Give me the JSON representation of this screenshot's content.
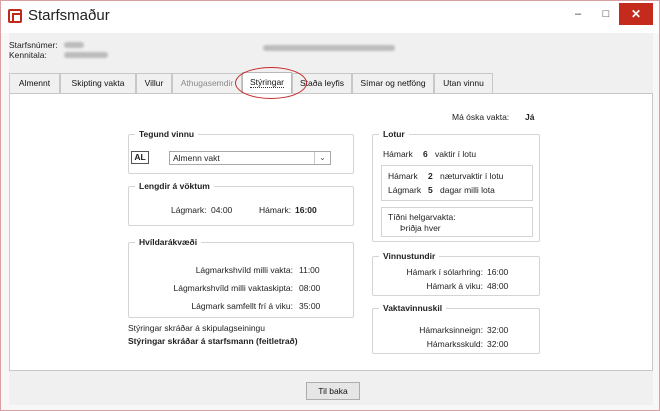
{
  "window": {
    "title": "Starfsmaður",
    "minimize_glyph": "–",
    "maximize_glyph": "□",
    "close_glyph": "✕"
  },
  "header": {
    "employee_number_label": "Starfsnúmer:",
    "ssn_label": "Kennitala:"
  },
  "tabs": [
    {
      "label": "Almennt",
      "state": "normal"
    },
    {
      "label": "Skipting vakta",
      "state": "normal"
    },
    {
      "label": "Villur",
      "state": "normal"
    },
    {
      "label": "Athugasemdir",
      "state": "disabled"
    },
    {
      "label": "Stýringar",
      "state": "active"
    },
    {
      "label": "Staða leyfis",
      "state": "normal"
    },
    {
      "label": "Símar og netföng",
      "state": "normal"
    },
    {
      "label": "Utan vinnu",
      "state": "normal"
    }
  ],
  "shift_wish": {
    "label": "Má óska vakta:",
    "value": "Já"
  },
  "work_type": {
    "title": "Tegund vinnu",
    "badge": "AL",
    "selected": "Almenn vakt"
  },
  "shift_length": {
    "title": "Lengdir á vöktum",
    "min_label": "Lágmark:",
    "min_value": "04:00",
    "max_label": "Hámark:",
    "max_value": "16:00"
  },
  "rest_rights": {
    "title": "Hvíldarákvæði",
    "rows": [
      {
        "label": "Lágmarkshvíld milli vakta:",
        "value": "11:00"
      },
      {
        "label": "Lágmarkshvíld milli vaktaskipta:",
        "value": "08:00"
      },
      {
        "label": "Lágmark samfellt frí á viku:",
        "value": "35:00"
      }
    ]
  },
  "footer_notes": {
    "unit_note": "Stýringar skráðar á skipulagseiningu",
    "employee_note": "Stýringar skráðar á starfsmann (feitletrað)"
  },
  "rounds": {
    "title": "Lotur",
    "max_label": "Hámark",
    "max_value": "6",
    "max_suffix": "vaktir í lotu",
    "night_max_label": "Hámark",
    "night_max_value": "2",
    "night_max_suffix": "næturvaktir í lotu",
    "min_days_label": "Lágmark",
    "min_days_value": "5",
    "min_days_suffix": "dagar milli lota",
    "weekend_label": "Tíðni helgarvakta:",
    "weekend_value": "Þriðja hver"
  },
  "work_hours": {
    "title": "Vinnustundir",
    "per_day_label": "Hámark í sólarhring:",
    "per_day_value": "16:00",
    "per_week_label": "Hámark á viku:",
    "per_week_value": "48:00"
  },
  "shift_duty": {
    "title": "Vaktavinnuskil",
    "credit_label": "Hámarksinneign:",
    "credit_value": "32:00",
    "debt_label": "Hámarksskuld:",
    "debt_value": "32:00"
  },
  "back_button": "Til baka"
}
